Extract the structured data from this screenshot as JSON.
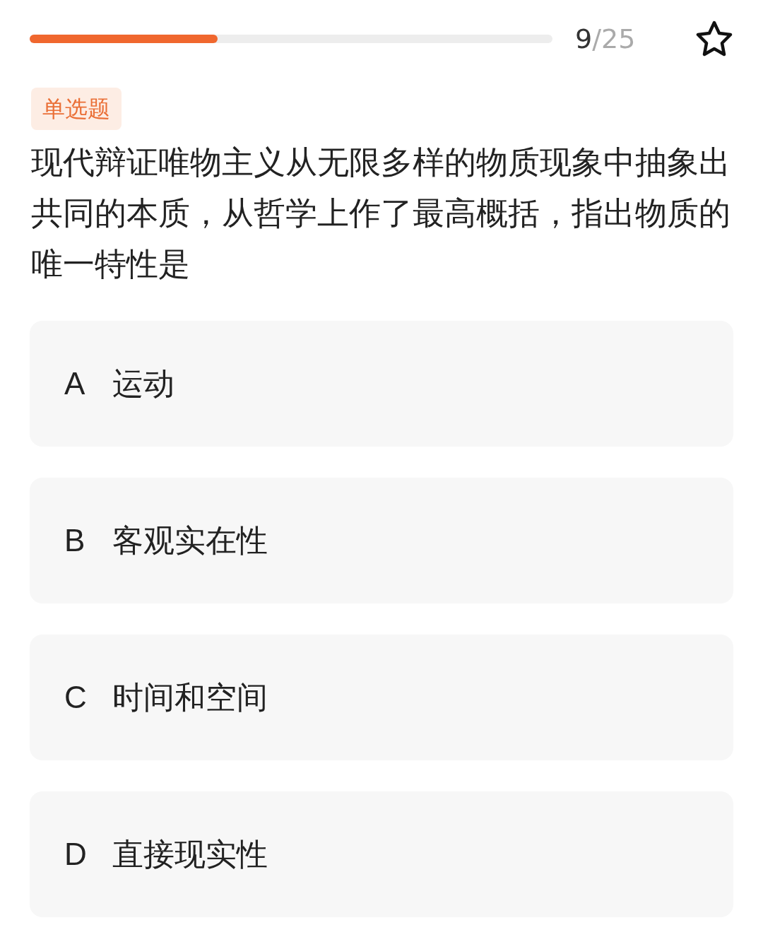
{
  "progress": {
    "level": 0.36,
    "current": "9",
    "total": "/25"
  },
  "question": {
    "type_tag": "单选题",
    "text": "现代辩证唯物主义从无限多样的物质现象中抽象出共同的本质，从哲学上作了最高概括，指出物质的唯一特性是"
  },
  "options": [
    {
      "letter": "A",
      "text": "运动",
      "selected": false
    },
    {
      "letter": "B",
      "text": "客观实在性",
      "selected": false
    },
    {
      "letter": "C",
      "text": "时间和空间",
      "selected": false
    },
    {
      "letter": "D",
      "text": "直接现实性",
      "selected": false
    }
  ]
}
